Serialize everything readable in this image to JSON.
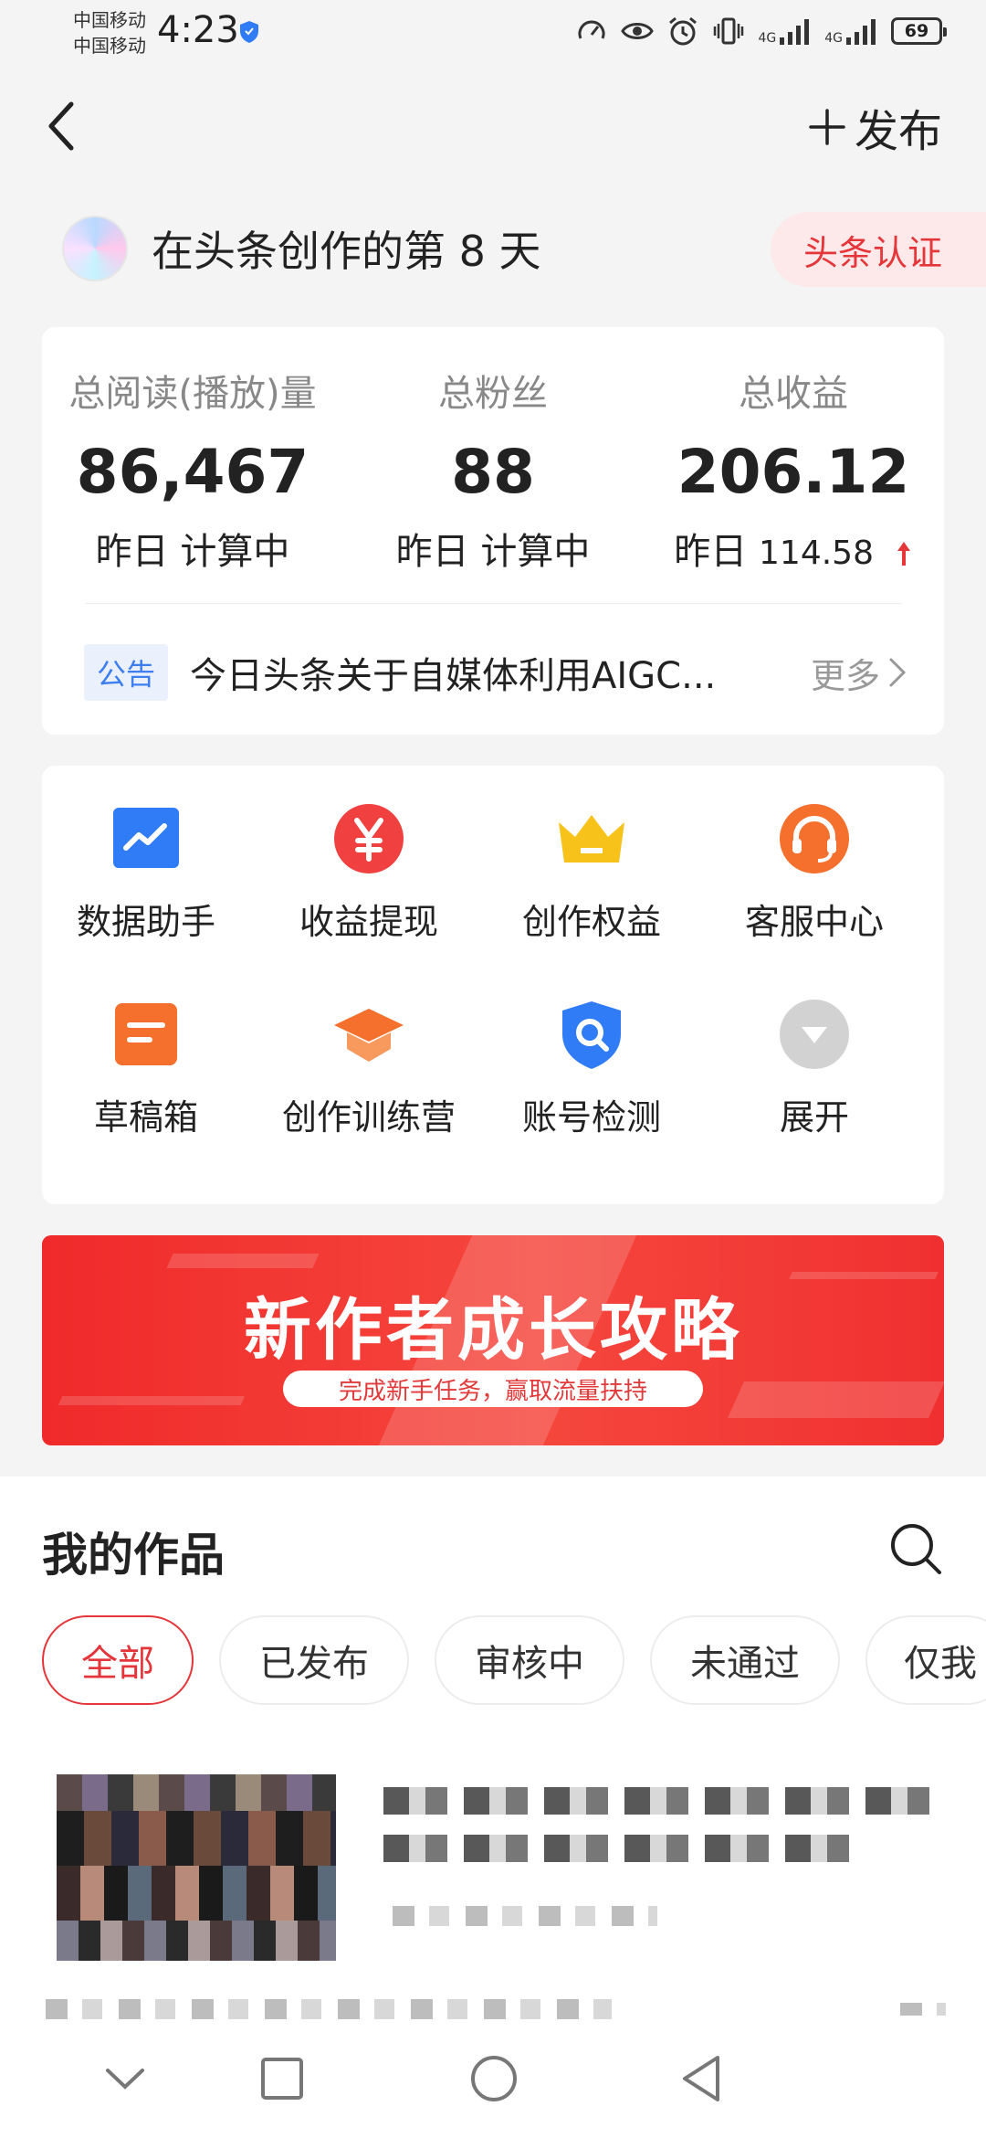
{
  "status_bar": {
    "carrier_1": "中国移动",
    "carrier_2": "中国移动",
    "time": "4:23",
    "network_1": "4G",
    "network_2": "4G",
    "battery": "69"
  },
  "nav": {
    "publish_label": "发布"
  },
  "creator": {
    "text": "在头条创作的第 8 天",
    "cert_label": "头条认证"
  },
  "stats": {
    "items": [
      {
        "label": "总阅读(播放)量",
        "value": "86,467",
        "sub": "昨日 计算中"
      },
      {
        "label": "总粉丝",
        "value": "88",
        "sub": "昨日 计算中"
      },
      {
        "label": "总收益",
        "value": "206.12",
        "sub_prefix": "昨日",
        "sub_value": "114.58",
        "trend": "up"
      }
    ],
    "notice_tag": "公告",
    "notice_text": "今日头条关于自媒体利用AIGC...",
    "more_label": "更多"
  },
  "tools": [
    {
      "label": "数据助手",
      "icon": "chart-icon",
      "color": "#2f7cf6"
    },
    {
      "label": "收益提现",
      "icon": "yuan-icon",
      "color": "#f04040"
    },
    {
      "label": "创作权益",
      "icon": "crown-icon",
      "color": "#f7c21a"
    },
    {
      "label": "客服中心",
      "icon": "headset-icon",
      "color": "#f5702d"
    },
    {
      "label": "草稿箱",
      "icon": "draft-icon",
      "color": "#f5702d"
    },
    {
      "label": "创作训练营",
      "icon": "graduation-cap-icon",
      "color": "#f5702d"
    },
    {
      "label": "账号检测",
      "icon": "shield-search-icon",
      "color": "#2f7cf6"
    },
    {
      "label": "展开",
      "icon": "expand-icon",
      "color": "#cfcfcf"
    }
  ],
  "banner": {
    "title": "新作者成长攻略",
    "subtitle": "完成新手任务，赢取流量扶持"
  },
  "works": {
    "title": "我的作品",
    "filters": [
      "全部",
      "已发布",
      "审核中",
      "未通过",
      "仅我"
    ],
    "active_filter": "全部"
  }
}
